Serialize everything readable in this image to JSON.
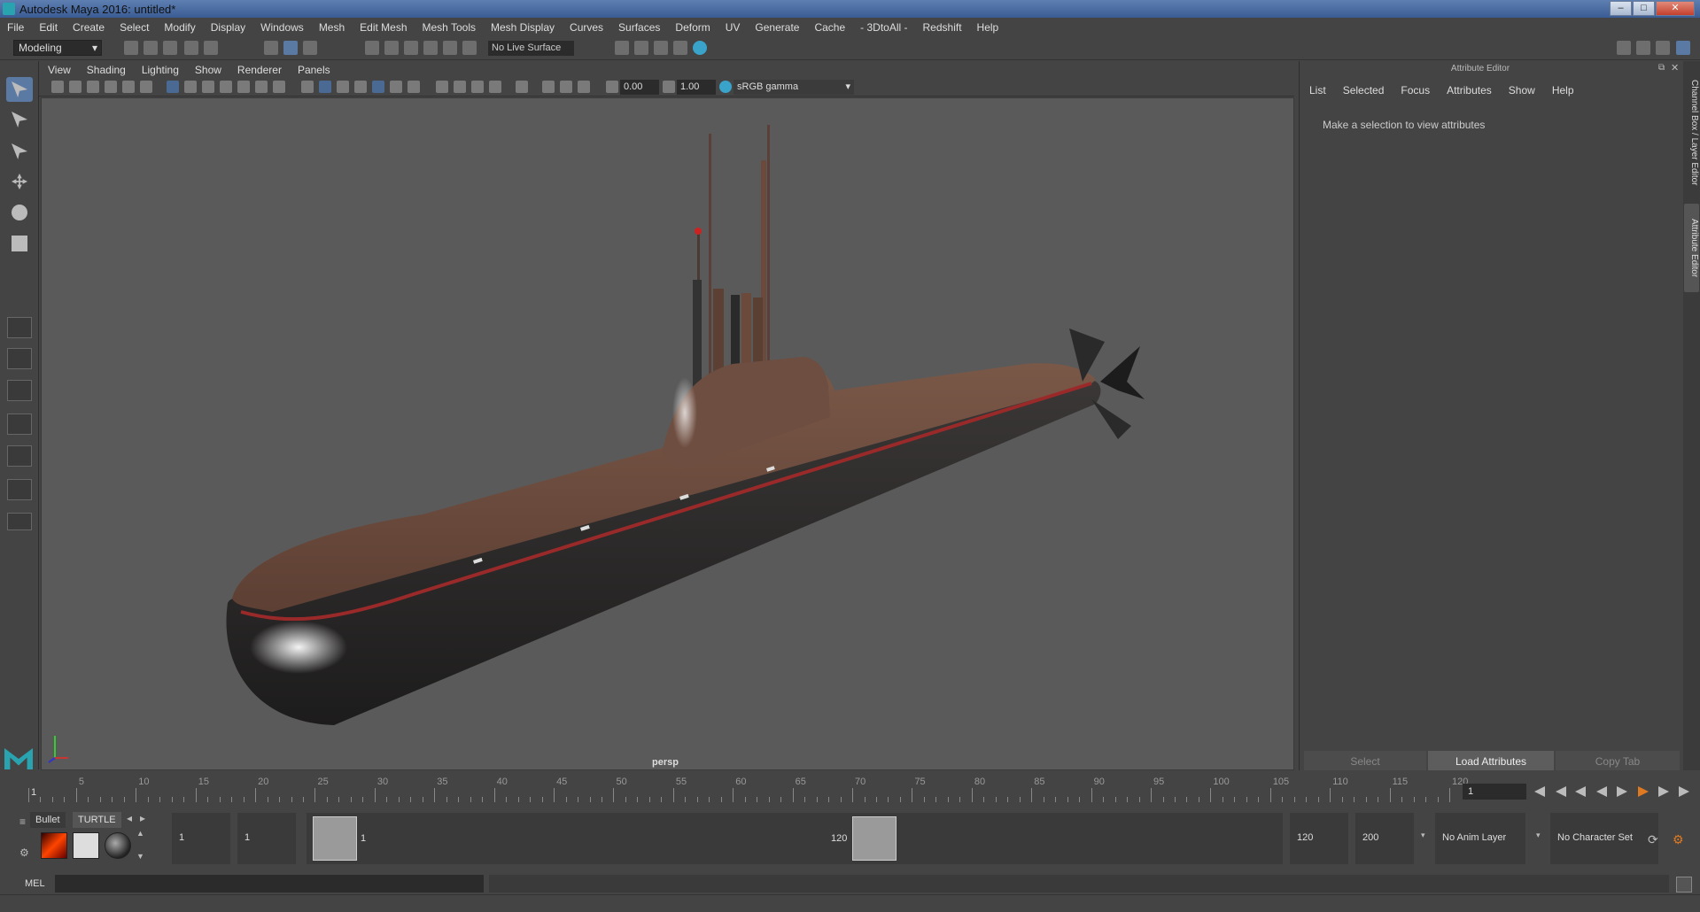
{
  "window": {
    "title": "Autodesk Maya 2016: untitled*"
  },
  "menubar": [
    "File",
    "Edit",
    "Create",
    "Select",
    "Modify",
    "Display",
    "Windows",
    "Mesh",
    "Edit Mesh",
    "Mesh Tools",
    "Mesh Display",
    "Curves",
    "Surfaces",
    "Deform",
    "UV",
    "Generate",
    "Cache",
    "- 3DtoAll -",
    "Redshift",
    "Help"
  ],
  "shelf": {
    "mode": "Modeling",
    "live_surface": "No Live Surface"
  },
  "viewport": {
    "menu": [
      "View",
      "Shading",
      "Lighting",
      "Show",
      "Renderer",
      "Panels"
    ],
    "exposure": "0.00",
    "gamma": "1.00",
    "color_space": "sRGB gamma",
    "camera_label": "persp"
  },
  "attribute_editor": {
    "title": "Attribute Editor",
    "menu": [
      "List",
      "Selected",
      "Focus",
      "Attributes",
      "Show",
      "Help"
    ],
    "message": "Make a selection to view attributes",
    "buttons": {
      "select": "Select",
      "load": "Load Attributes",
      "copy": "Copy Tab"
    },
    "side_tabs": [
      "Channel Box / Layer Editor",
      "Attribute Editor"
    ]
  },
  "timeline": {
    "ticks": [
      "1",
      "5",
      "10",
      "15",
      "20",
      "25",
      "30",
      "35",
      "40",
      "45",
      "50",
      "55",
      "60",
      "65",
      "70",
      "75",
      "80",
      "85",
      "90",
      "95",
      "100",
      "105",
      "110",
      "115",
      "120"
    ],
    "current_frame": "1"
  },
  "range": {
    "start": "1",
    "playback_start": "1",
    "range_start_label": "1",
    "range_end_label": "120",
    "playback_end": "120",
    "end": "200",
    "anim_layer": "No Anim Layer",
    "character_set": "No Character Set"
  },
  "shelf_tabs": {
    "bullet": "Bullet",
    "turtle": "TURTLE"
  },
  "command_line": {
    "label": "MEL"
  },
  "colors": {
    "hull_upper": "#6e4e40",
    "hull_lower": "#2c2c2c",
    "stripe": "#9a2a2a",
    "viewport_bg": "#5a5a5a",
    "accent": "#5b7aa3"
  }
}
